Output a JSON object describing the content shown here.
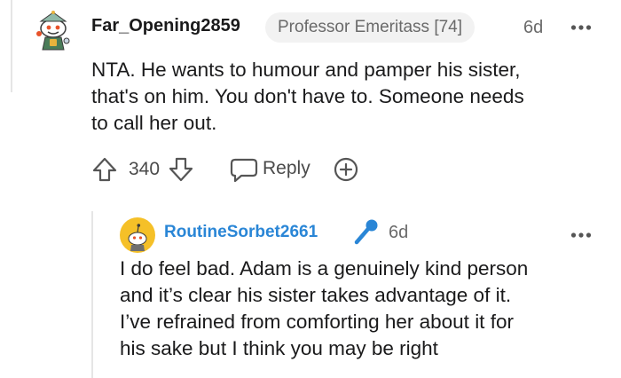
{
  "comment": {
    "author": "Far_Opening2859",
    "flair": "Professor Emeritass [74]",
    "age": "6d",
    "body_lines": [
      "NTA. He wants to humour and pamper his sister,",
      "that's on him. You don't have to. Someone needs",
      "to call her out."
    ],
    "score": "340",
    "reply_label": "Reply"
  },
  "reply": {
    "author": "RoutineSorbet2661",
    "age": "6d",
    "body_lines": [
      "I do feel bad. Adam is a genuinely kind person",
      "and it’s clear his sister takes advantage of it.",
      "I’ve refrained from comforting her about it for",
      "his sake but I think you may be right"
    ]
  },
  "icons": {
    "avatar_1": "snoo-avatar-icon",
    "upvote": "upvote-arrow-icon",
    "downvote": "downvote-arrow-icon",
    "reply": "speech-bubble-icon",
    "award": "award-plus-icon",
    "more": "more-options-icon",
    "avatar_2": "snoo-avatar-icon",
    "op_badge": "microphone-icon"
  },
  "colors": {
    "reply_author": "#2a86d6",
    "avatar_2_bg": "#f5c028",
    "text": "#1a1a1b",
    "muted": "#6a6a6a"
  }
}
